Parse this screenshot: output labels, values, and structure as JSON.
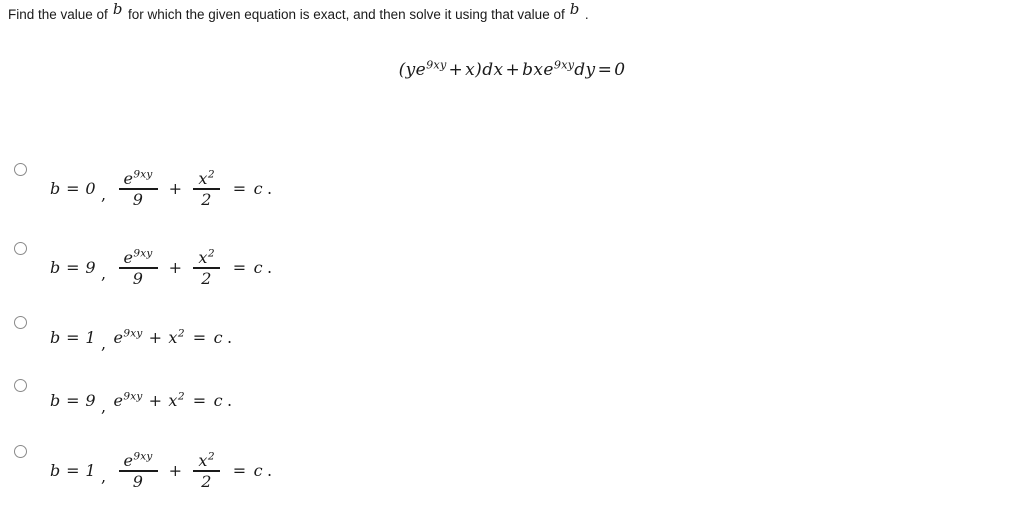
{
  "prompt": {
    "part1": "Find the value of",
    "var1": "b",
    "part2": "for which the given equation is exact, and then solve it using that value of",
    "var2": "b",
    "part3": "."
  },
  "equation": {
    "open_paren": "(",
    "term1_base": "ye",
    "term1_exp": "9xy",
    "plus": "+",
    "term2": "x",
    "close_paren": ")",
    "dx": "dx",
    "plus2": "+",
    "term3_base": "bxe",
    "term3_exp": "9xy",
    "dy": "dy",
    "equals": "=",
    "zero": "0"
  },
  "symbols": {
    "b_label": "b",
    "equals": "=",
    "comma": ",",
    "plus": "+",
    "e": "e",
    "exponent": "9xy",
    "x": "x",
    "square": "2",
    "c": "c",
    "period": "."
  },
  "options": [
    {
      "id": "option-1",
      "b_assignment": "b = 0",
      "form": "fraction",
      "frac1_num_base": "e",
      "frac1_num_exp": "9xy",
      "frac1_den": "9",
      "frac2_num_base": "x",
      "frac2_num_exp": "2",
      "frac2_den": "2",
      "result": "c",
      "selected": false
    },
    {
      "id": "option-2",
      "b_assignment": "b = 9",
      "form": "fraction",
      "frac1_num_base": "e",
      "frac1_num_exp": "9xy",
      "frac1_den": "9",
      "frac2_num_base": "x",
      "frac2_num_exp": "2",
      "frac2_den": "2",
      "result": "c",
      "selected": false
    },
    {
      "id": "option-3",
      "b_assignment": "b = 1",
      "form": "inline",
      "term1_base": "e",
      "term1_exp": "9xy",
      "term2_base": "x",
      "term2_exp": "2",
      "result": "c",
      "selected": false
    },
    {
      "id": "option-4",
      "b_assignment": "b = 9",
      "form": "inline",
      "term1_base": "e",
      "term1_exp": "9xy",
      "term2_base": "x",
      "term2_exp": "2",
      "result": "c",
      "selected": false
    },
    {
      "id": "option-5",
      "b_assignment": "b = 1",
      "form": "fraction",
      "frac1_num_base": "e",
      "frac1_num_exp": "9xy",
      "frac1_den": "9",
      "frac2_num_base": "x",
      "frac2_num_exp": "2",
      "frac2_den": "2",
      "result": "c",
      "selected": false
    }
  ],
  "colors": {
    "background": "#ffffff",
    "text": "#1a1a1a",
    "radio_border": "#8a8a8a"
  }
}
